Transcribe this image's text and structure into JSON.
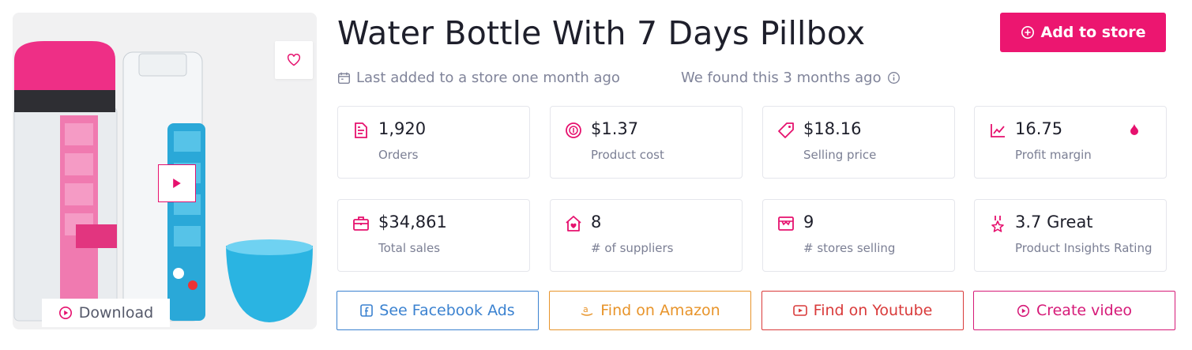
{
  "product": {
    "title": "Water Bottle With 7 Days Pillbox",
    "add_to_store_label": "Add to store",
    "last_added": "Last added to a store one month ago",
    "found": "We found this 3 months ago",
    "download_label": "Download"
  },
  "stats": [
    {
      "value": "1,920",
      "label": "Orders",
      "icon": "document-icon"
    },
    {
      "value": "$1.37",
      "label": "Product cost",
      "icon": "coins-icon"
    },
    {
      "value": "$18.16",
      "label": "Selling price",
      "icon": "price-tag-icon"
    },
    {
      "value": "16.75",
      "label": "Profit margin",
      "icon": "chart-line-icon"
    },
    {
      "value": "$34,861",
      "label": "Total sales",
      "icon": "briefcase-icon"
    },
    {
      "value": "8",
      "label": "# of suppliers",
      "icon": "home-heart-icon"
    },
    {
      "value": "9",
      "label": "# stores selling",
      "icon": "store-icon"
    },
    {
      "value": "3.7 Great",
      "label": "Product Insights Rating",
      "icon": "award-icon"
    }
  ],
  "actions": [
    {
      "label": "See Facebook Ads",
      "color": "#3b82d0"
    },
    {
      "label": "Find on Amazon",
      "color": "#e8942a"
    },
    {
      "label": "Find on Youtube",
      "color": "#d93a3a"
    },
    {
      "label": "Create video",
      "color": "#d61a78"
    }
  ],
  "colors": {
    "accent": "#ec1670",
    "text_muted": "#7b7f94",
    "border": "#e5e6ec"
  }
}
